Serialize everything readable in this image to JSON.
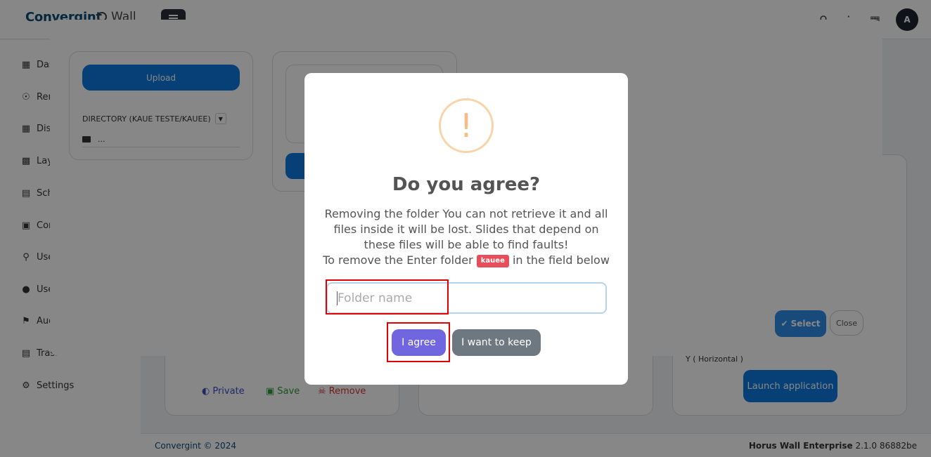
{
  "topbar": {
    "brand": "Convergint",
    "app": "Wall",
    "avatar": "A"
  },
  "sidebar": {
    "items": [
      {
        "label": "Dashboard",
        "icon": "grid-icon"
      },
      {
        "label": "Remote",
        "icon": "satellite-icon"
      },
      {
        "label": "Displays",
        "icon": "grid-icon"
      },
      {
        "label": "Layouts",
        "icon": "layout-icon"
      },
      {
        "label": "Schedules",
        "icon": "calendar-icon"
      },
      {
        "label": "Connections",
        "icon": "car-icon"
      },
      {
        "label": "Users",
        "icon": "key-icon"
      },
      {
        "label": "User groups",
        "icon": "users-icon"
      },
      {
        "label": "Audit",
        "icon": "flag-icon"
      },
      {
        "label": "Trash",
        "icon": "trash-icon"
      },
      {
        "label": "Settings",
        "icon": "gear-icon"
      }
    ]
  },
  "background_card": {
    "private": "Private",
    "save": "Save",
    "remove": "Remove",
    "orientation": "Y ( Horizontal )",
    "launch": "Launch application"
  },
  "file_modal": {
    "upload": "Upload",
    "directory": "DIRECTORY (KAUE TESTE/KAUEE)",
    "dir_item": "...",
    "select": "Select",
    "close": "Close"
  },
  "dialog": {
    "title": "Do you agree?",
    "text_line1": "Removing the folder You can not retrieve it and all files inside it will be lost. Slides that depend on these files will be able to find faults!",
    "text_line2_pre": "To remove the Enter folder",
    "folder_badge": "kauee",
    "text_line2_post": "in the field below",
    "input_placeholder": "Folder name",
    "confirm": "I agree",
    "cancel": "I want to keep"
  },
  "footer": {
    "left": "Convergint © 2024",
    "product": "Horus Wall Enterprise",
    "version": "2.1.0 86882be"
  }
}
